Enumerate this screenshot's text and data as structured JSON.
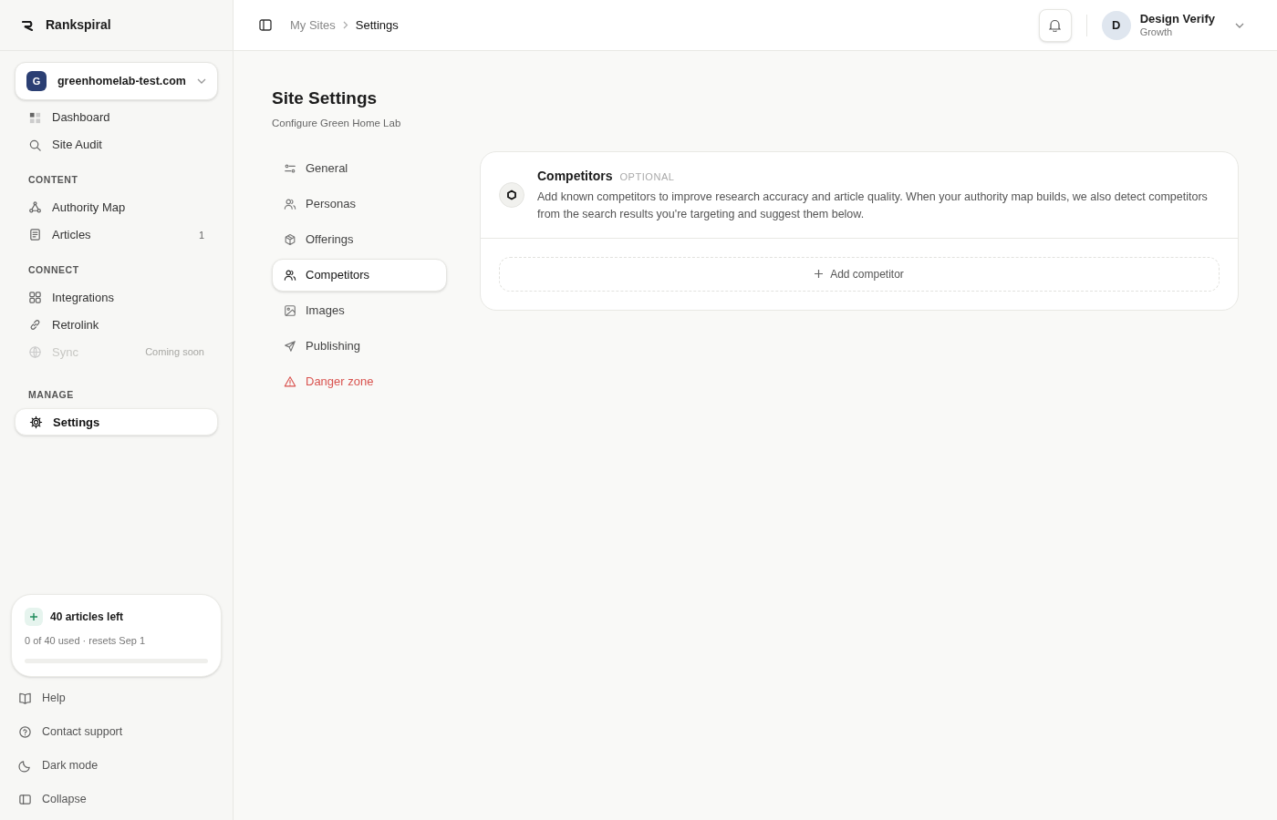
{
  "brand": {
    "name": "Rankspiral"
  },
  "site_switcher": {
    "initial": "G",
    "domain": "greenhomelab-test.com"
  },
  "sidebar": {
    "sections": [
      {
        "items": [
          {
            "label": "Dashboard",
            "selected": false,
            "disabled": false
          },
          {
            "label": "Site Audit",
            "selected": false,
            "disabled": false
          }
        ]
      },
      {
        "header": "CONTENT",
        "items": [
          {
            "label": "Authority Map",
            "selected": false,
            "disabled": false
          },
          {
            "label": "Articles",
            "badge": "1",
            "selected": false,
            "disabled": false
          }
        ]
      },
      {
        "header": "CONNECT",
        "items": [
          {
            "label": "Integrations",
            "selected": false,
            "disabled": false
          },
          {
            "label": "Retrolink",
            "selected": false,
            "disabled": false
          },
          {
            "label": "Sync",
            "note": "Coming soon",
            "selected": false,
            "disabled": true
          }
        ]
      },
      {
        "header": "MANAGE",
        "items": [
          {
            "label": "Settings",
            "selected": true,
            "disabled": false
          }
        ]
      }
    ]
  },
  "usage": {
    "title": "40 articles left",
    "detail": "0 of 40 used · resets Sep 1",
    "level": 0
  },
  "footer_links": [
    "Help",
    "Contact support",
    "Dark mode",
    "Collapse"
  ],
  "breadcrumb": [
    "My Sites",
    "Settings"
  ],
  "user": {
    "initial": "D",
    "name": "Design Verify",
    "plan": "Growth"
  },
  "page": {
    "title": "Site Settings",
    "subtitle": "Configure Green Home Lab"
  },
  "settings_nav": [
    {
      "label": "General",
      "selected": false,
      "danger": false
    },
    {
      "label": "Personas",
      "selected": false,
      "danger": false
    },
    {
      "label": "Offerings",
      "selected": false,
      "danger": false
    },
    {
      "label": "Competitors",
      "selected": true,
      "danger": false
    },
    {
      "label": "Images",
      "selected": false,
      "danger": false
    },
    {
      "label": "Publishing",
      "selected": false,
      "danger": false
    },
    {
      "label": "Danger zone",
      "selected": false,
      "danger": true
    }
  ],
  "panel": {
    "title": "Competitors",
    "tag": "OPTIONAL",
    "description": "Add known competitors to improve research accuracy and article quality. When your authority map builds, we also detect competitors from the search results you're targeting and suggest them below.",
    "add_button": "Add competitor"
  }
}
